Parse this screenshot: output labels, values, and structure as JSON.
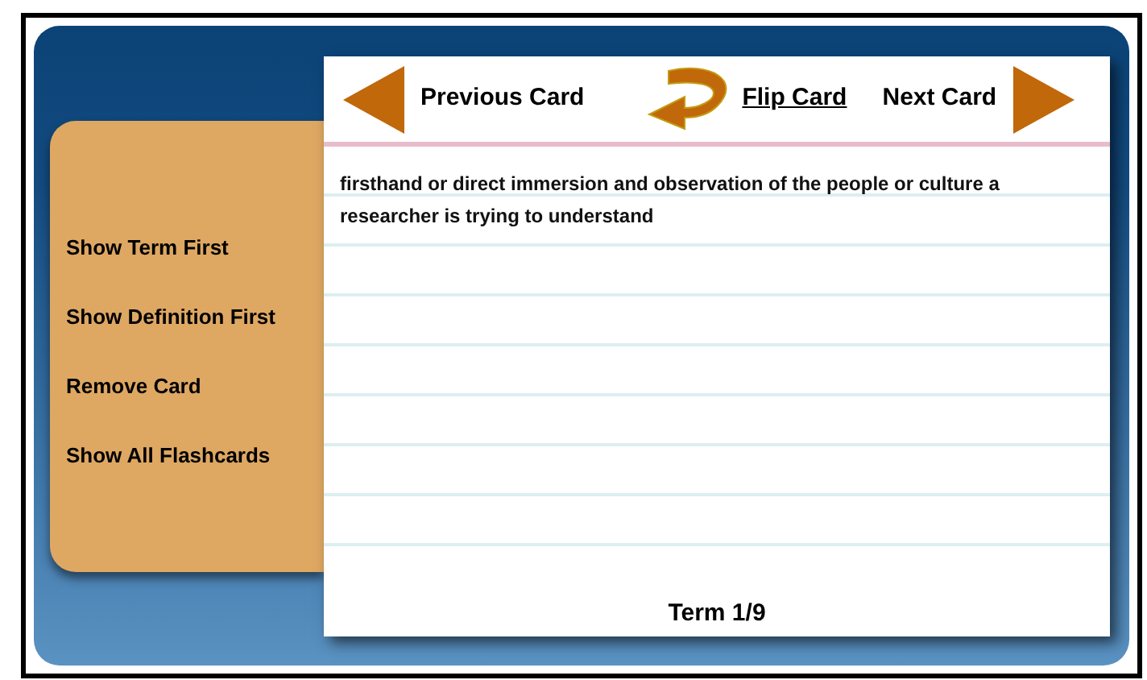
{
  "nav": {
    "previous": "Previous Card",
    "flip": "Flip Card",
    "next": "Next Card"
  },
  "sidebar": {
    "items": [
      {
        "label": "Show Term First"
      },
      {
        "label": "Show Definition First"
      },
      {
        "label": "Remove Card"
      },
      {
        "label": "Show All Flashcards"
      }
    ]
  },
  "card": {
    "text": "firsthand or direct immersion and observation of the people or culture a researcher is trying to understand",
    "counter": "Term 1/9"
  }
}
